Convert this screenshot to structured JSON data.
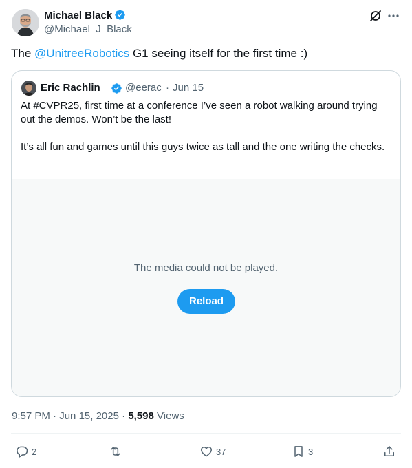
{
  "author": {
    "name": "Michael Black",
    "handle": "@Michael_J_Black"
  },
  "tweet": {
    "text_before": "The ",
    "mention": "@UnitreeRobotics",
    "text_after": " G1 seeing itself for the first time :)"
  },
  "quote": {
    "name": "Eric Rachlin",
    "handle": "@eerac",
    "separator": "·",
    "date": "Jun 15",
    "paragraph1": "At #CVPR25, first time at a conference I’ve seen a robot walking around trying out the demos. Won’t be the last!",
    "paragraph2": "It’s all fun and games until this guys twice as tall and the one writing the checks.",
    "media_message": "The media could not be played.",
    "reload_label": "Reload"
  },
  "meta": {
    "time": "9:57 PM",
    "date": "Jun 15, 2025",
    "separator": "·",
    "views_count": "5,598",
    "views_label": "Views"
  },
  "actions": {
    "replies": "2",
    "likes": "37",
    "bookmarks": "3"
  },
  "colors": {
    "accent": "#1d9bf0",
    "secondary_text": "#536471",
    "border": "#cfd9de",
    "media_bg": "#f7f9f9"
  },
  "icons": [
    "verified-badge-icon",
    "grok-icon",
    "more-icon",
    "reply-icon",
    "retweet-icon",
    "like-icon",
    "bookmark-icon",
    "share-icon"
  ]
}
